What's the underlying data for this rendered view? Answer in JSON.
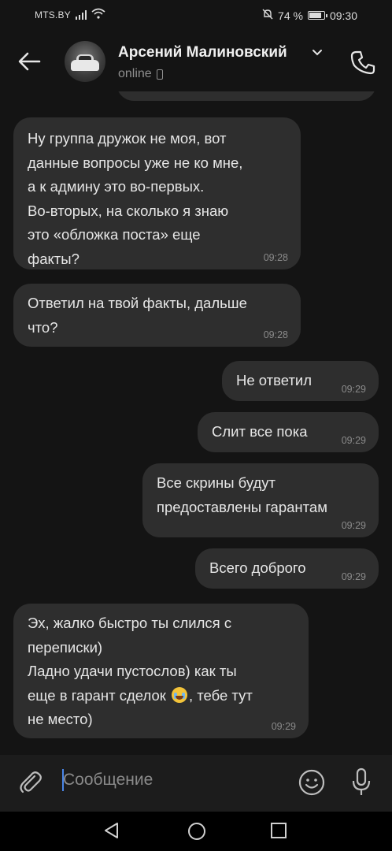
{
  "status_bar": {
    "carrier": "MTS.BY",
    "battery": "74 %",
    "battery_level": 0.74,
    "time": "09:30"
  },
  "header": {
    "contact_name": "Арсений Малиновский",
    "status": "online"
  },
  "messages": [
    {
      "side": "in",
      "text": "Ну группа дружок не моя, вот\nданные вопросы уже не ко мне,\nа к админу это во-первых.\nВо-вторых, на сколько я знаю\nэто «обложка поста» еще\nфакты?",
      "time": "09:28"
    },
    {
      "side": "in",
      "text": "Ответил на твой факты, дальше\nчто?",
      "time": "09:28"
    },
    {
      "side": "out",
      "text": "Не ответил",
      "time": "09:29"
    },
    {
      "side": "out",
      "text": "Слит все пока",
      "time": "09:29"
    },
    {
      "side": "out",
      "text": "Все скрины будут\nпредоставлены гарантам",
      "time": "09:29"
    },
    {
      "side": "out",
      "text": "Всего доброго",
      "time": "09:29"
    },
    {
      "side": "in",
      "text_before_emoji": "Эх, жалко быстро ты слился с\nпереписки)\nЛадно удачи пустослов) как ты\nеще в гарант сделок ",
      "emoji": "crying-laughing-emoji",
      "text_after_emoji": ", тебе тут\nне место)",
      "time": "09:29"
    }
  ],
  "input": {
    "placeholder": "Сообщение"
  },
  "colors": {
    "background": "#141414",
    "bubble": "#2e2e2e",
    "caret": "#4a86e8"
  }
}
